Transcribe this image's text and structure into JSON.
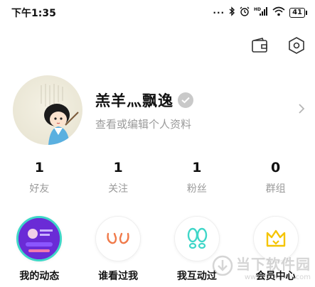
{
  "status_bar": {
    "time": "下午1:35",
    "battery": "41",
    "dots": "···",
    "hd": "HD",
    "icons": [
      "dots-icon",
      "bluetooth-icon",
      "alarm-icon",
      "hd-signal-icon",
      "wifi-icon",
      "battery-icon"
    ]
  },
  "top_actions": {
    "icons": [
      "wallet-icon",
      "settings-hexagon-icon"
    ]
  },
  "profile": {
    "nickname": "羔羊灬飘逸",
    "edit_hint": "查看或编辑个人资料"
  },
  "stats": [
    {
      "value": "1",
      "label": "好友"
    },
    {
      "value": "1",
      "label": "关注"
    },
    {
      "value": "1",
      "label": "粉丝"
    },
    {
      "value": "0",
      "label": "群组"
    }
  ],
  "shortcuts": [
    {
      "label": "我的动态",
      "icon": "my-dynamic-thumbnail"
    },
    {
      "label": "谁看过我",
      "icon": "glasses-icon"
    },
    {
      "label": "我互动过",
      "icon": "footprints-icon"
    },
    {
      "label": "会员中心",
      "icon": "vip-crown-icon"
    }
  ],
  "watermark": {
    "text": "当下软件园",
    "url": "www.downxia.com"
  },
  "colors": {
    "accent_orange": "#f07a4a",
    "accent_teal": "#3fd6c8",
    "accent_yellow": "#f5c400",
    "dynamic_purple": "#6a2bd6",
    "muted_text": "#9a9a9a"
  }
}
